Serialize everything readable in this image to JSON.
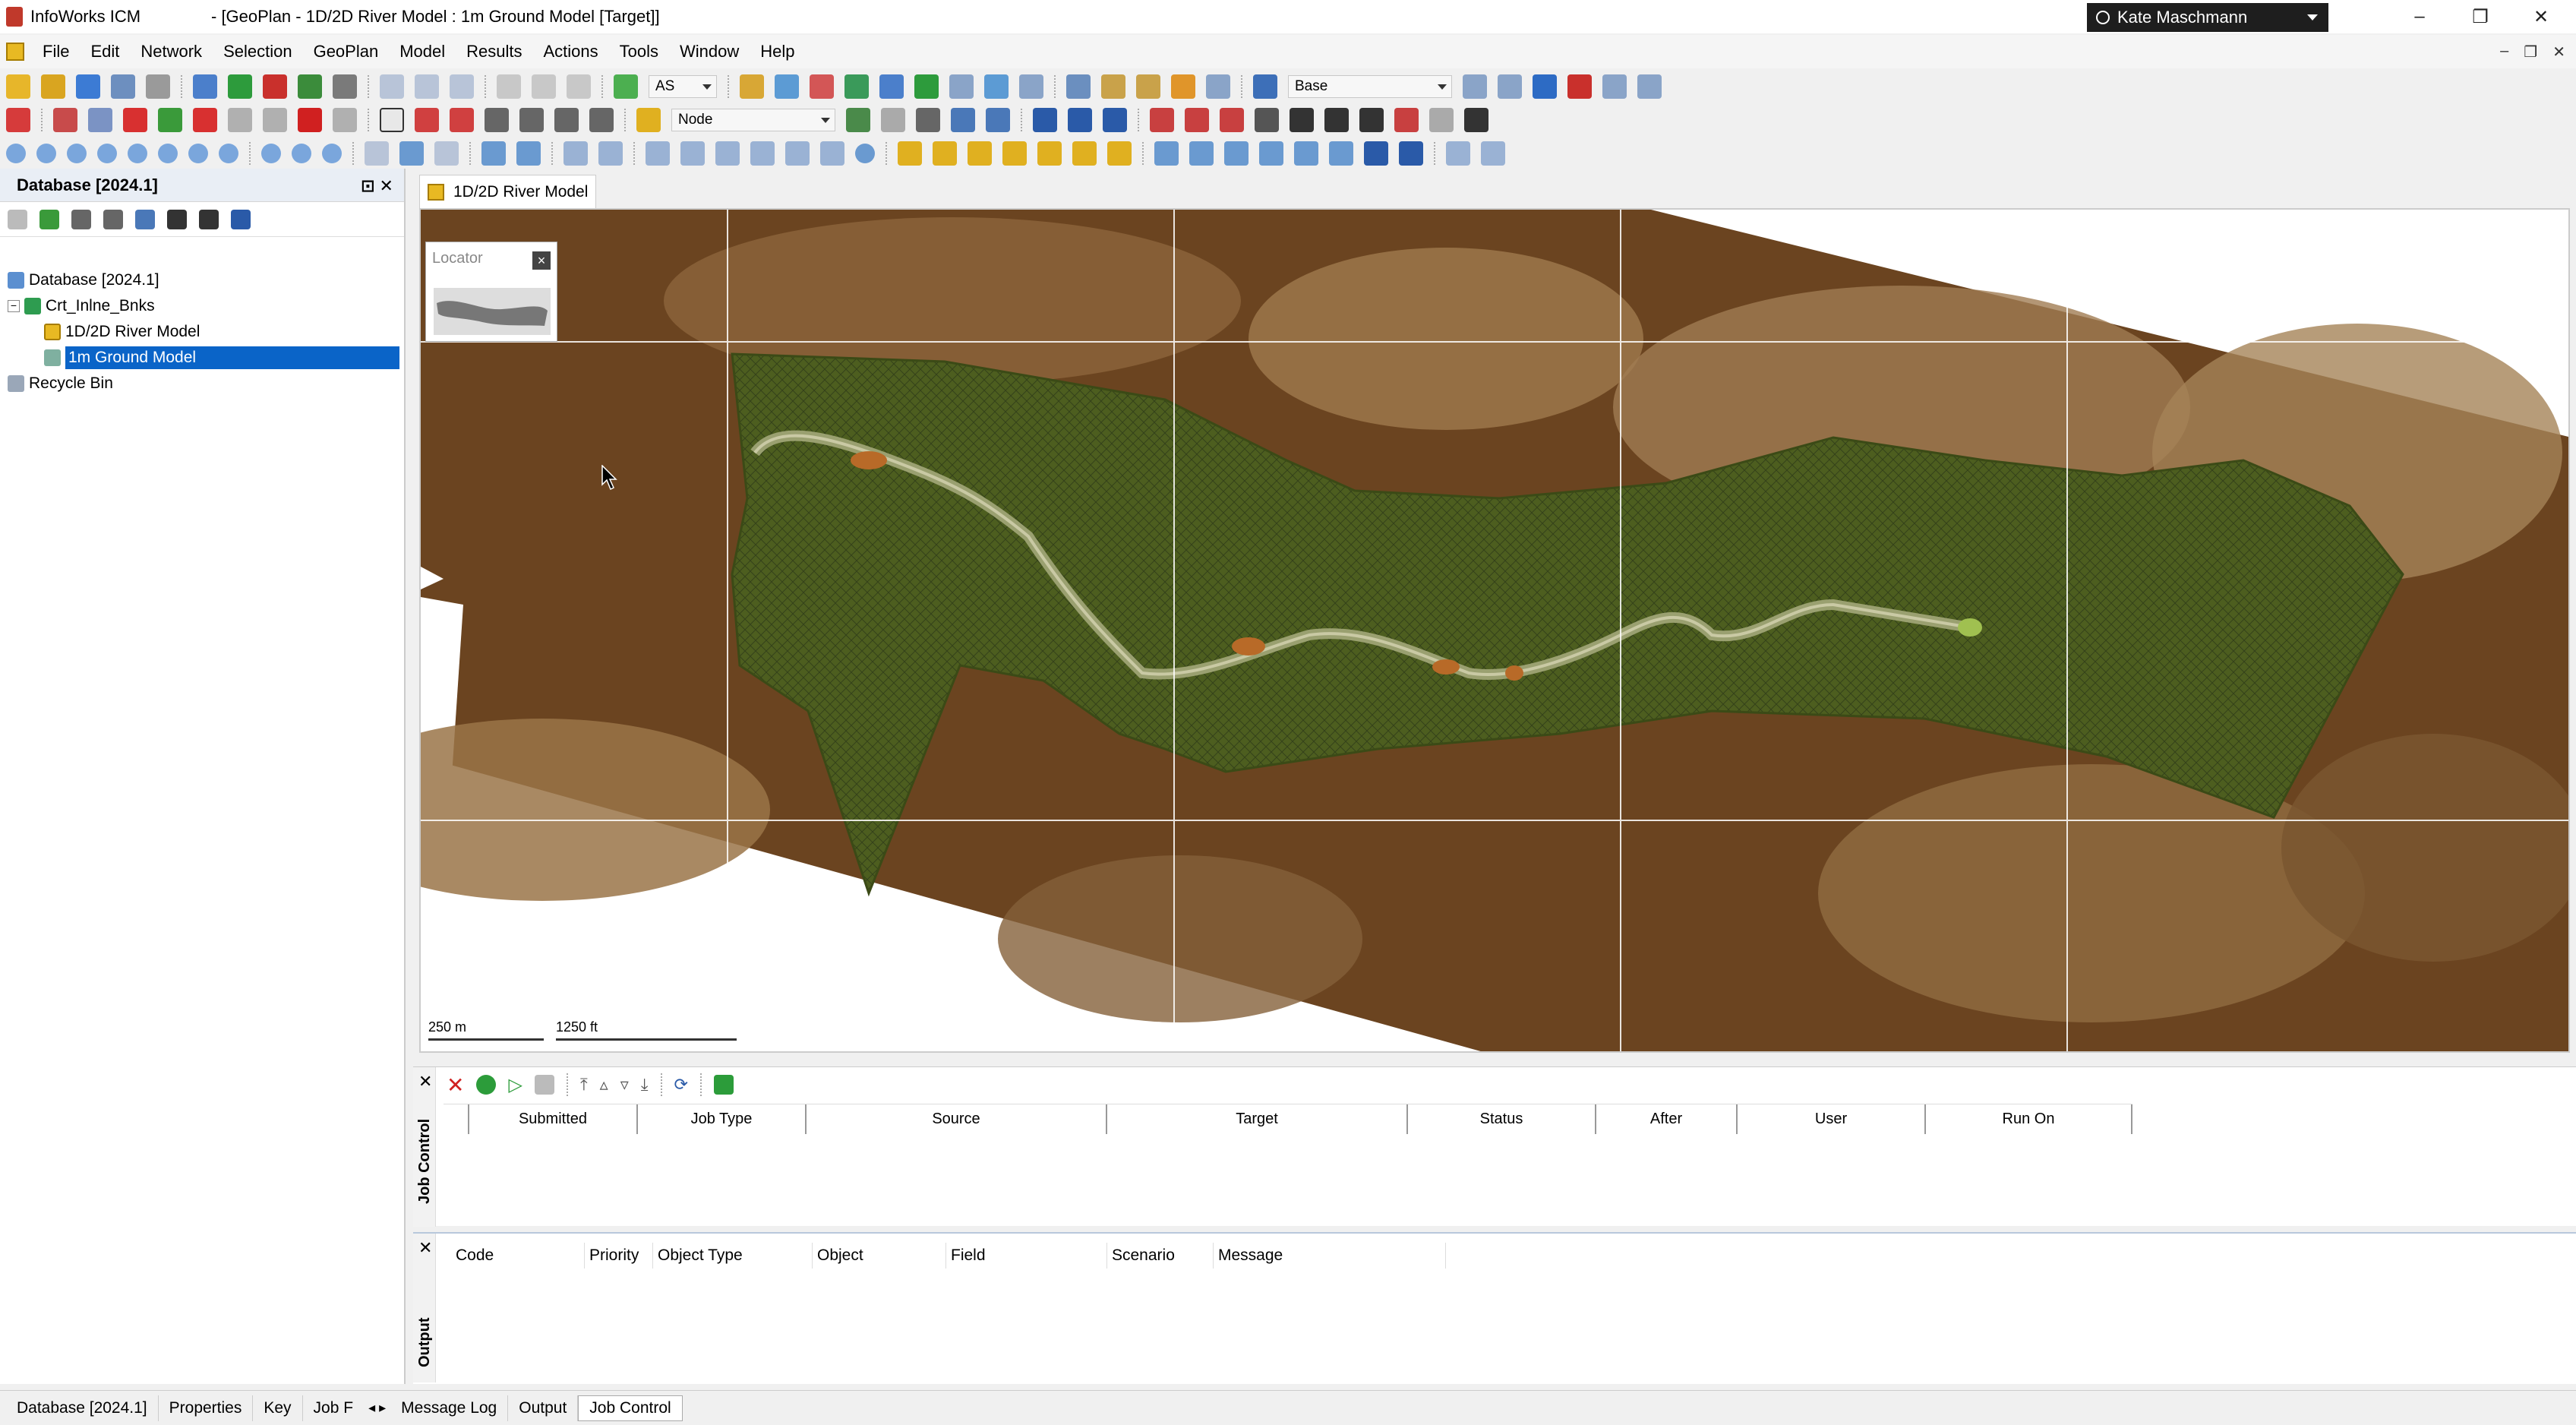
{
  "window": {
    "app_name": "InfoWorks ICM",
    "doc_title": "- [GeoPlan - 1D/2D River Model : 1m Ground Model  [Target]]",
    "user_name": "Kate Maschmann",
    "minimize": "–",
    "restore": "❐",
    "close": "✕"
  },
  "menu": [
    "File",
    "Edit",
    "Network",
    "Selection",
    "GeoPlan",
    "Model",
    "Results",
    "Actions",
    "Tools",
    "Window",
    "Help"
  ],
  "toolbar": {
    "as_combo": "AS",
    "base_combo": "Base",
    "node_combo": "Node"
  },
  "database_panel": {
    "title": "Database [2024.1]",
    "tree": {
      "root": "Database [2024.1]",
      "group": "Crt_Inlne_Bnks",
      "model": "1D/2D River Model",
      "ground_model": "1m Ground Model",
      "recycle": "Recycle Bin"
    }
  },
  "map": {
    "tab_label": "1D/2D River Model",
    "locator_title": "Locator",
    "scale_m": "250 m",
    "scale_ft": "1250 ft"
  },
  "job_control": {
    "label": "Job Control",
    "columns": [
      "Submitted",
      "Job Type",
      "Source",
      "Target",
      "Status",
      "After",
      "User",
      "Run On"
    ]
  },
  "output": {
    "label": "Output",
    "columns": [
      "Code",
      "Priority",
      "Object Type",
      "Object",
      "Field",
      "Scenario",
      "Message"
    ]
  },
  "bottom_tabs": [
    "Database [2024.1]",
    "Properties",
    "Key",
    "Job F",
    "Message Log",
    "Output",
    "Job Control"
  ],
  "colors": {
    "selection_blue": "#0a64c8",
    "terrain_dark": "#6b4420",
    "mesh_green": "#4a5a1c"
  }
}
